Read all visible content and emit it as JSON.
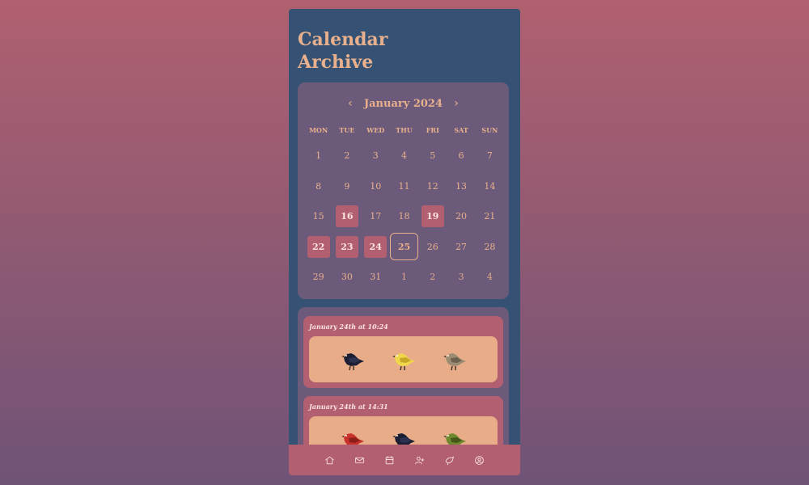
{
  "page": {
    "title": "Calendar Archive"
  },
  "calendar": {
    "month_label": "January 2024",
    "prev_icon": "‹",
    "next_icon": "›",
    "weekdays": [
      "MON",
      "TUE",
      "WED",
      "THU",
      "FRI",
      "SAT",
      "SUN"
    ],
    "days": [
      {
        "n": "1"
      },
      {
        "n": "2"
      },
      {
        "n": "3"
      },
      {
        "n": "4"
      },
      {
        "n": "5"
      },
      {
        "n": "6"
      },
      {
        "n": "7"
      },
      {
        "n": "8"
      },
      {
        "n": "9"
      },
      {
        "n": "10"
      },
      {
        "n": "11"
      },
      {
        "n": "12"
      },
      {
        "n": "13"
      },
      {
        "n": "14"
      },
      {
        "n": "15"
      },
      {
        "n": "16",
        "marked": true
      },
      {
        "n": "17"
      },
      {
        "n": "18"
      },
      {
        "n": "19",
        "marked": true
      },
      {
        "n": "20"
      },
      {
        "n": "21"
      },
      {
        "n": "22",
        "marked": true
      },
      {
        "n": "23",
        "marked": true
      },
      {
        "n": "24",
        "marked": true
      },
      {
        "n": "25",
        "today": true
      },
      {
        "n": "26"
      },
      {
        "n": "27"
      },
      {
        "n": "28"
      },
      {
        "n": "29"
      },
      {
        "n": "30"
      },
      {
        "n": "31"
      },
      {
        "n": "1",
        "outside": true
      },
      {
        "n": "2",
        "outside": true
      },
      {
        "n": "3",
        "outside": true
      },
      {
        "n": "4",
        "outside": true
      }
    ]
  },
  "entries": [
    {
      "when": "January 24th at 10:24",
      "birds": [
        {
          "icon": "crow-icon",
          "color": "#1c1f33",
          "accent": "#2d3150"
        },
        {
          "icon": "canary-icon",
          "color": "#f1d54a",
          "accent": "#c9a727"
        },
        {
          "icon": "quail-icon",
          "color": "#9c8c72",
          "accent": "#6e6150"
        }
      ]
    },
    {
      "when": "January 24th at 14:31",
      "birds": [
        {
          "icon": "cardinal-icon",
          "color": "#c8322a",
          "accent": "#8c1f1a"
        },
        {
          "icon": "crow-icon",
          "color": "#1c1f33",
          "accent": "#2d3150"
        },
        {
          "icon": "finch-icon",
          "color": "#6f8a2e",
          "accent": "#46571c"
        }
      ]
    }
  ],
  "nav": [
    {
      "icon": "home-icon"
    },
    {
      "icon": "mail-icon"
    },
    {
      "icon": "calendar-icon"
    },
    {
      "icon": "add-user-icon"
    },
    {
      "icon": "bird-icon"
    },
    {
      "icon": "profile-icon"
    }
  ],
  "colors": {
    "accent": "#e8b08c",
    "card": "#6c5a7a",
    "highlight": "#b35f72",
    "panel": "#355274"
  }
}
